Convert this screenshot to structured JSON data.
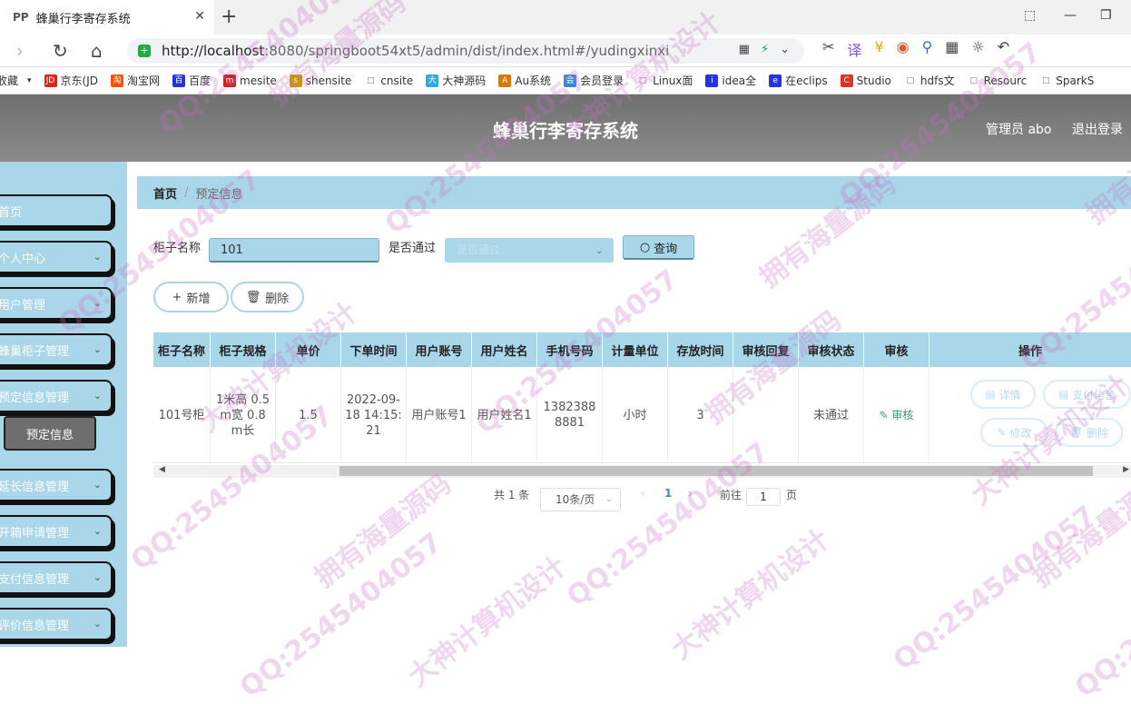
{
  "browser": {
    "tab_title": "蜂巢行李寄存系统",
    "tab_favicon": "PP",
    "url_host": "http://localhost",
    "url_rest": ":8080/springboot54xt5/admin/dist/index.html#/yudingxinxi"
  },
  "bookmarks": [
    {
      "label": "收藏",
      "icon": "",
      "color": "#ffffff"
    },
    {
      "label": "京东(JD",
      "icon": "JD",
      "color": "#e1251b"
    },
    {
      "label": "淘宝网",
      "icon": "淘",
      "color": "#ff5000"
    },
    {
      "label": "百度",
      "icon": "百",
      "color": "#2932e1"
    },
    {
      "label": "mesite",
      "icon": "m",
      "color": "#cc2222"
    },
    {
      "label": "shensite",
      "icon": "s",
      "color": "#c99a00"
    },
    {
      "label": "cnsite",
      "icon": "□",
      "color": "#999999"
    },
    {
      "label": "大神源码",
      "icon": "大",
      "color": "#33aadd"
    },
    {
      "label": "Au系统",
      "icon": "A",
      "color": "#dd7700"
    },
    {
      "label": "会员登录",
      "icon": "会",
      "color": "#3388dd"
    },
    {
      "label": "Linux面",
      "icon": "□",
      "color": "#999999"
    },
    {
      "label": "idea全",
      "icon": "i",
      "color": "#2932e1"
    },
    {
      "label": "在eclips",
      "icon": "e",
      "color": "#2932e1"
    },
    {
      "label": "Studio",
      "icon": "C",
      "color": "#dd3322"
    },
    {
      "label": "hdfs文",
      "icon": "□",
      "color": "#999999"
    },
    {
      "label": "Resourc",
      "icon": "□",
      "color": "#999999"
    },
    {
      "label": "SparkS",
      "icon": "□",
      "color": "#999999"
    }
  ],
  "header": {
    "title": "蜂巢行李寄存系统",
    "admin": "管理员 abo",
    "logout": "退出登录"
  },
  "sidebar": {
    "items": [
      {
        "label": "首页",
        "chevron": false
      },
      {
        "label": "个人中心",
        "chevron": true
      },
      {
        "label": "用户管理",
        "chevron": true
      },
      {
        "label": "蜂巢柜子管理",
        "chevron": true
      },
      {
        "label": "预定信息管理",
        "chevron": true
      },
      {
        "label": "延长信息管理",
        "chevron": true
      },
      {
        "label": "开箱申请管理",
        "chevron": true
      },
      {
        "label": "支付信息管理",
        "chevron": true
      },
      {
        "label": "评价信息管理",
        "chevron": true
      }
    ],
    "active_sub": "预定信息"
  },
  "breadcrumb": {
    "home": "首页",
    "current": "预定信息"
  },
  "filters": {
    "cabinet_label": "柜子名称",
    "cabinet_value": "101",
    "pass_label": "是否通过",
    "pass_placeholder": "是否通过",
    "query_label": "查询"
  },
  "actions": {
    "add_label": "新增",
    "delete_label": "删除"
  },
  "table": {
    "columns": [
      "柜子名称",
      "柜子规格",
      "单价",
      "下单时间",
      "用户账号",
      "用户姓名",
      "手机号码",
      "计量单位",
      "存放时间",
      "审核回复",
      "审核状态",
      "审核",
      "操作"
    ],
    "rows": [
      {
        "cabinet_name": "101号柜",
        "spec": "1米高 0.5m宽 0.8m长",
        "price": "1.5",
        "order_time": "2022-09-18 14:15:21",
        "account": "用户账号1",
        "name": "用户姓名1",
        "phone": "13823888881",
        "unit": "小时",
        "duration": "3",
        "reply": "",
        "status": "未通过",
        "audit": "审核",
        "ops": {
          "detail": "详情",
          "pay": "支付信息",
          "edit": "修改",
          "delete": "删除"
        }
      }
    ]
  },
  "pagination": {
    "total": "共 1 条",
    "page_size": "10条/页",
    "current_page": "1",
    "goto_prefix": "前往",
    "goto_value": "1",
    "goto_suffix": "页"
  },
  "watermark": {
    "qq": "QQ:2545404057",
    "t1": "拥有海量源码",
    "t2": "大神计算机设计"
  },
  "colors": {
    "accent": "#a9d6e8",
    "header": "#7a7a7a",
    "audit": "#3a9a6a"
  }
}
